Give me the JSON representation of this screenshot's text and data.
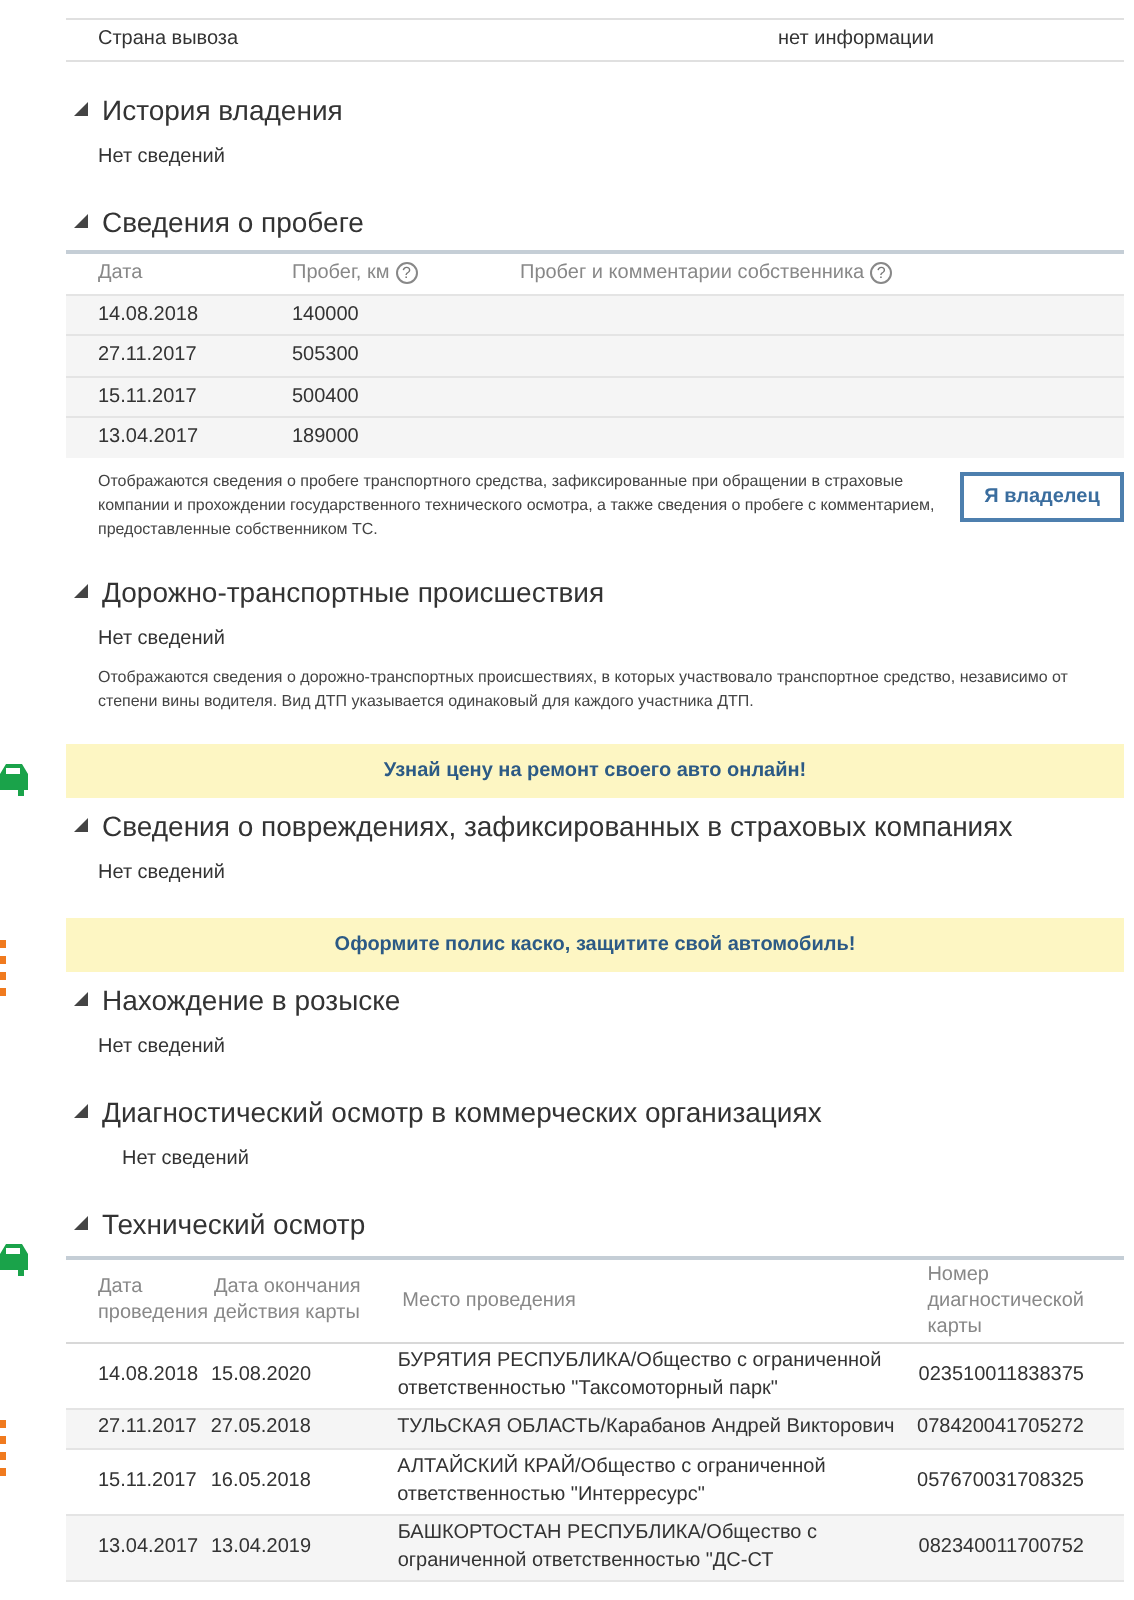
{
  "vehicle_info": [
    {
      "label": "Страна вывоза",
      "value": "нет информации"
    }
  ],
  "blocks": [
    {
      "kind": "section",
      "title": "История владения",
      "empty_text": "Нет сведений"
    },
    {
      "kind": "section",
      "title": "Сведения о пробеге",
      "table": {
        "kind": "mileage",
        "columns": [
          {
            "label": "Дата"
          },
          {
            "label": "Пробег, км",
            "help": "?"
          },
          {
            "label": "Пробег и комментарии собственника",
            "help": "?"
          }
        ],
        "rows": [
          [
            "14.08.2018",
            "140000"
          ],
          [
            "27.11.2017",
            "505300"
          ],
          [
            "15.11.2017",
            "500400"
          ],
          [
            "13.04.2017",
            "189000"
          ]
        ]
      },
      "note": "Отображаются сведения о пробеге транспортного средства, зафиксированные при обращении в страховые компании и прохождении государственного технического осмотра, а также сведения о пробеге с комментарием, предоставленные собственником ТС.",
      "button": "Я владелец"
    },
    {
      "kind": "section",
      "title": "Дорожно-транспортные происшествия",
      "empty_text": "Нет сведений",
      "note": "Отображаются сведения о дорожно-транспортных происшествиях, в которых участвовало транспортное средство, независимо от степени вины водителя. Вид ДТП указывается одинаковый для каждого участника ДТП."
    },
    {
      "kind": "banner",
      "text": "Узнай цену на ремонт своего авто онлайн!"
    },
    {
      "kind": "section",
      "title": "Сведения о повреждениях, зафиксированных в страховых компаниях",
      "empty_text": "Нет сведений"
    },
    {
      "kind": "banner",
      "text": "Оформите полис каско, защитите свой автомобиль!"
    },
    {
      "kind": "section",
      "title": "Нахождение в розыске",
      "empty_text": "Нет сведений"
    },
    {
      "kind": "section",
      "title": "Диагностический осмотр в коммерческих организациях",
      "empty_text": "Нет сведений",
      "indented": true
    },
    {
      "kind": "section",
      "title": "Технический осмотр",
      "table": {
        "kind": "inspection",
        "columns": [
          {
            "label": "Дата проведения"
          },
          {
            "label": "Дата окончания действия карты"
          },
          {
            "label": "Место проведения"
          },
          {
            "label": "Номер диагностической карты"
          }
        ],
        "rows": [
          [
            "14.08.2018",
            "15.08.2020",
            "БУРЯТИЯ РЕСПУБЛИКА/Общество с ограниченной ответственностью \"Таксомоторный парк\"",
            "023510011838375"
          ],
          [
            "27.11.2017",
            "27.05.2018",
            "ТУЛЬСКАЯ ОБЛАСТЬ/Карабанов Андрей Викторович",
            "078420041705272"
          ],
          [
            "15.11.2017",
            "16.05.2018",
            "АЛТАЙСКИЙ КРАЙ/Общество с ограниченной ответственностью \"Интерресурс\"",
            "057670031708325"
          ],
          [
            "13.04.2017",
            "13.04.2019",
            "БАШКОРТОСТАН РЕСПУБЛИКА/Общество с ограниченной ответственностью \"ДС-СТ",
            "082340011700752"
          ]
        ]
      }
    }
  ]
}
